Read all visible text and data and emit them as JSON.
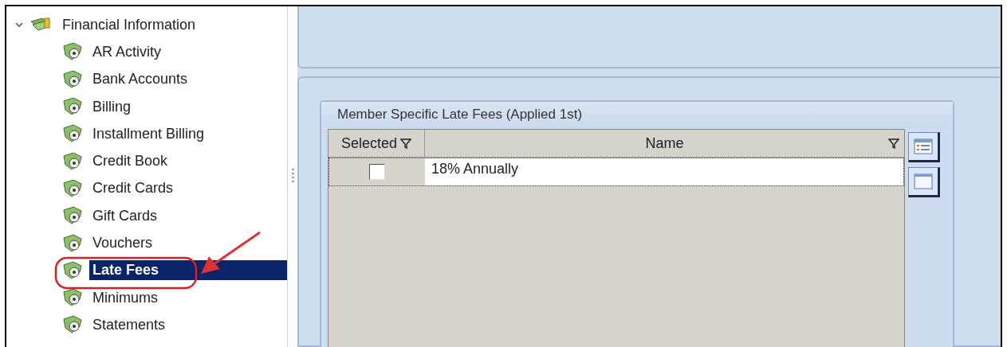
{
  "tree": [
    {
      "label": "Financial Information",
      "expanded": true,
      "children": [
        {
          "label": "AR Activity",
          "selected": false
        },
        {
          "label": "Bank Accounts",
          "selected": false
        },
        {
          "label": "Billing",
          "selected": false
        },
        {
          "label": "Installment Billing",
          "selected": false
        },
        {
          "label": "Credit Book",
          "selected": false
        },
        {
          "label": "Credit Cards",
          "selected": false
        },
        {
          "label": "Gift Cards",
          "selected": false
        },
        {
          "label": "Vouchers",
          "selected": false
        },
        {
          "label": "Late Fees",
          "selected": true
        },
        {
          "label": "Minimums",
          "selected": false
        },
        {
          "label": "Statements",
          "selected": false
        }
      ]
    }
  ],
  "group": {
    "title": "Member Specific Late Fees (Applied 1st)",
    "columns": [
      {
        "label": "Selected",
        "filter": true
      },
      {
        "label": "Name",
        "filter": true
      }
    ],
    "rows": [
      {
        "checked": false,
        "name": "18% Annually"
      }
    ]
  }
}
